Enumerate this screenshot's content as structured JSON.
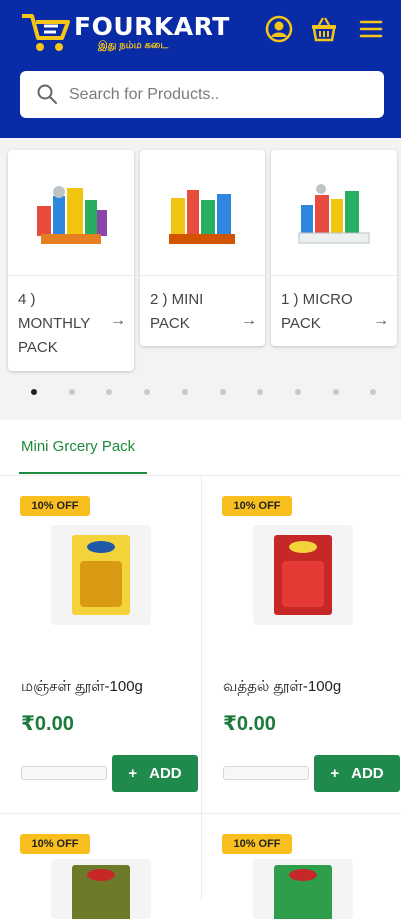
{
  "header": {
    "brand": "FOURKART",
    "tagline": "இது நம்ம கடை",
    "icons": [
      "account-icon",
      "basket-icon",
      "menu-icon"
    ],
    "colors": {
      "background": "#0a2ba6",
      "accent": "#f5c518"
    }
  },
  "search": {
    "placeholder": "Search for Products.."
  },
  "categories": [
    {
      "label": "4 ) MONTHLY PACK"
    },
    {
      "label": "2 ) MINI PACK"
    },
    {
      "label": "1 ) MICRO PACK"
    }
  ],
  "carousel": {
    "dot_count": 10,
    "active_index": 0
  },
  "tabs": {
    "active": "Mini Grcery Pack"
  },
  "products": [
    {
      "badge": "10% OFF",
      "name": "மஞ்சள் தூள்-100g",
      "price": "₹0.00",
      "add_label": "ADD",
      "add_icon": "+"
    },
    {
      "badge": "10% OFF",
      "name": "வத்தல் தூள்-100g",
      "price": "₹0.00",
      "add_label": "ADD",
      "add_icon": "+"
    },
    {
      "badge": "10% OFF"
    },
    {
      "badge": "10% OFF"
    }
  ],
  "colors": {
    "green": "#1c8a3a",
    "badge": "#f8bf1f",
    "button": "#1f8a4c"
  }
}
